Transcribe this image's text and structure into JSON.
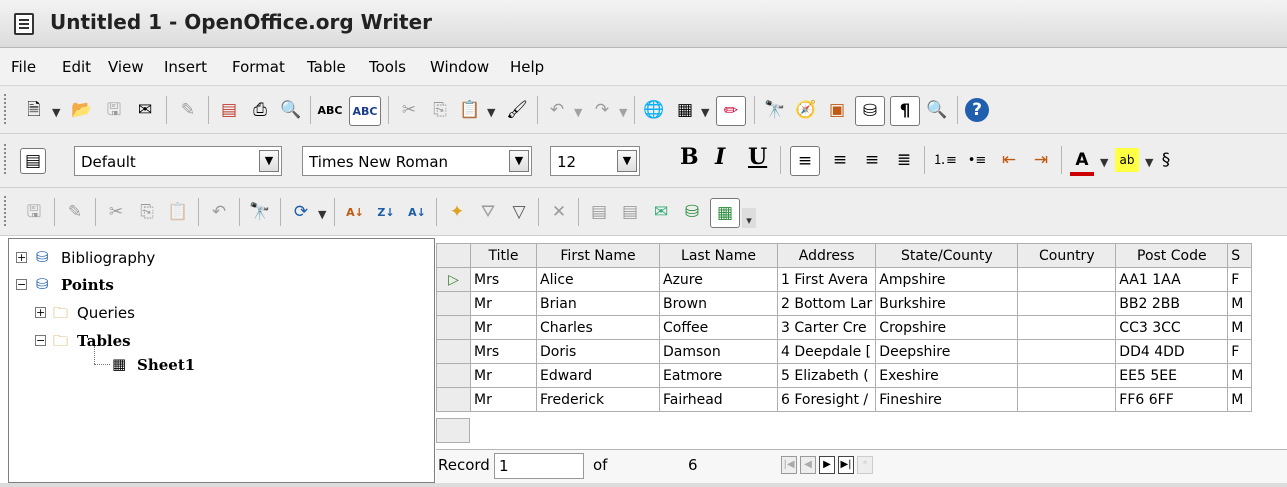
{
  "window": {
    "title": "Untitled 1 - OpenOffice.org Writer"
  },
  "menu": [
    "File",
    "Edit",
    "View",
    "Insert",
    "Format",
    "Table",
    "Tools",
    "Window",
    "Help"
  ],
  "toolbar_icons": {
    "standard": [
      "new-document-icon",
      "open-folder-icon",
      "save-icon",
      "email-icon",
      "edit-file-icon",
      "export-pdf-icon",
      "print-icon",
      "page-preview-icon",
      "spellcheck-icon",
      "autospellcheck-icon",
      "cut-icon",
      "copy-icon",
      "paste-icon",
      "format-paintbrush-icon",
      "undo-icon",
      "redo-icon",
      "hyperlink-icon",
      "table-icon",
      "draw-functions-icon",
      "find-replace-icon",
      "navigator-icon",
      "gallery-icon",
      "data-sources-icon",
      "nonprinting-chars-icon",
      "zoom-icon",
      "help-icon"
    ],
    "datasource": [
      "save-record-icon",
      "edit-data-icon",
      "cut-icon",
      "copy-icon",
      "paste-icon",
      "undo-icon",
      "find-record-icon",
      "refresh-icon",
      "sort-ascending-icon",
      "sort-descending-icon",
      "sort-icon",
      "autofilter-icon",
      "standard-filter-icon",
      "remove-filter-icon",
      "delete-record-icon",
      "data-to-text-icon",
      "data-to-fields-icon",
      "mail-merge-icon",
      "data-source-current-icon",
      "explorer-on-off-icon"
    ]
  },
  "formatting": {
    "style": "Default",
    "font": "Times New Roman",
    "size": "12",
    "bold_label": "B",
    "italic_label": "I",
    "underline_label": "U"
  },
  "tree": {
    "bibliography": "Bibliography",
    "points": "Points",
    "queries": "Queries",
    "tables": "Tables",
    "sheet": "Sheet1"
  },
  "table": {
    "columns": [
      "Title",
      "First Name",
      "Last Name",
      "Address",
      "State/County",
      "Country",
      "Post Code",
      "S"
    ],
    "rows": [
      [
        "Mrs",
        "Alice",
        "Azure",
        "1 First Avera",
        "Ampshire",
        "",
        "AA1 1AA",
        "F"
      ],
      [
        "Mr",
        "Brian",
        "Brown",
        "2 Bottom Lar",
        "Burkshire",
        "",
        "BB2 2BB",
        "M"
      ],
      [
        "Mr",
        "Charles",
        "Coffee",
        "3 Carter Cre",
        "Cropshire",
        "",
        "CC3 3CC",
        "M"
      ],
      [
        "Mrs",
        "Doris",
        "Damson",
        "4 Deepdale [",
        "Deepshire",
        "",
        "DD4 4DD",
        "F"
      ],
      [
        "Mr",
        "Edward",
        "Eatmore",
        "5 Elizabeth (",
        "Exeshire",
        "",
        "EE5 5EE",
        "M"
      ],
      [
        "Mr",
        "Frederick",
        "Fairhead",
        "6 Foresight /",
        "Fineshire",
        "",
        "FF6 6FF",
        "M"
      ]
    ]
  },
  "record_bar": {
    "label": "Record",
    "current": "1",
    "of_label": "of",
    "total": "6"
  },
  "colors": {
    "accent": "#3a6ea5",
    "current_row_marker": "#3a9a2f"
  }
}
